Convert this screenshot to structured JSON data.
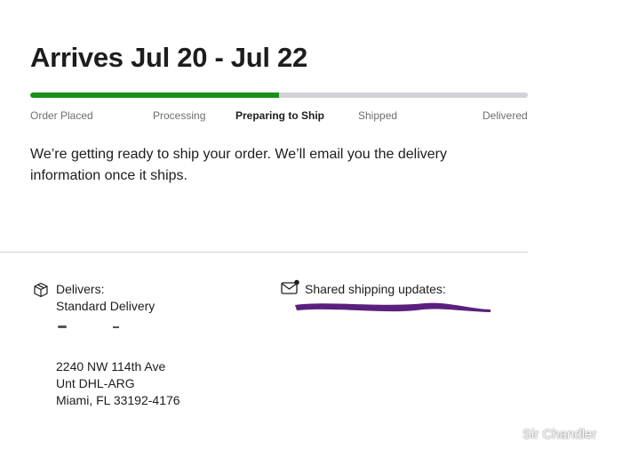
{
  "header": {
    "title": "Arrives Jul 20 - Jul 22"
  },
  "progress": {
    "fraction": 0.5,
    "fill_color": "#1a8f1a",
    "track_color": "#d2d2d7",
    "steps": [
      {
        "label": "Order Placed",
        "active": false
      },
      {
        "label": "Processing",
        "active": false
      },
      {
        "label": "Preparing to Ship",
        "active": true
      },
      {
        "label": "Shipped",
        "active": false
      },
      {
        "label": "Delivered",
        "active": false
      }
    ]
  },
  "status_message": "We’re getting ready to ship your order. We’ll email you the delivery information once it ships.",
  "delivery": {
    "icon": "package-icon",
    "label": "Delivers:",
    "method": "Standard Delivery",
    "address_lines": [
      "2240 NW 114th Ave",
      "Unt DHL-ARG",
      "Miami, FL 33192-4176"
    ]
  },
  "shipping_updates": {
    "icon": "envelope-icon",
    "label": "Shared shipping updates:",
    "redaction_color": "#5b1f7e"
  },
  "watermark": "Sir Chandler"
}
